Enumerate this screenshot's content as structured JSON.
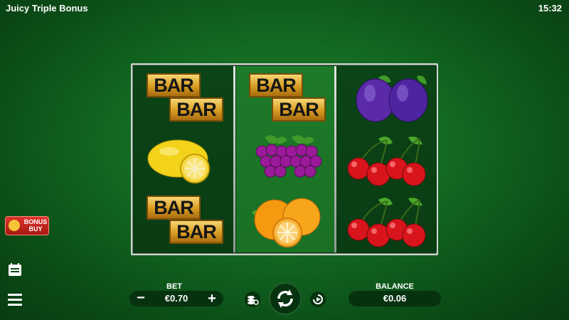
{
  "header": {
    "title": "Juicy Triple Bonus",
    "clock": "15:32"
  },
  "reels": [
    {
      "symbols": [
        "double-bar",
        "lemon",
        "double-bar"
      ]
    },
    {
      "symbols": [
        "double-bar",
        "grapes",
        "orange"
      ]
    },
    {
      "symbols": [
        "plum",
        "cherry",
        "cherry"
      ]
    }
  ],
  "symbol_text": {
    "bar": "BAR"
  },
  "bonus_buy": {
    "label_line1": "BONUS",
    "label_line2": "BUY",
    "icon": "crown-icon"
  },
  "controls": {
    "bet_label": "BET",
    "bet_value": "€0.70",
    "minus": "−",
    "plus": "+",
    "balance_label": "BALANCE",
    "balance_value": "€0.06",
    "icons": [
      "paytable-icon",
      "menu-icon",
      "autoplay-icon",
      "spin-icon",
      "turbo-icon"
    ]
  },
  "colors": {
    "frame": "#cfd6d0",
    "bonus_buy": "#c9241c",
    "accent_gold": "#e0a93a"
  }
}
